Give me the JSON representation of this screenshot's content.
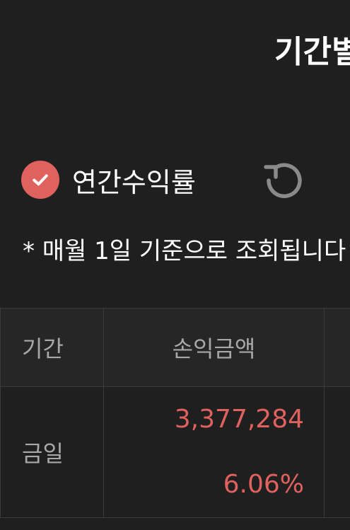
{
  "header": {
    "title": "기간별"
  },
  "option": {
    "checked": true,
    "label": "연간수익률",
    "accent_color": "#e0625f"
  },
  "note": "* 매월 1일 기준으로 조회됩니다",
  "table": {
    "columns": [
      "기간",
      "손익금액",
      ""
    ],
    "rows": [
      {
        "period": "금일",
        "amount": "3,377,284",
        "rate": "6.06%"
      }
    ]
  },
  "icons": {
    "check": "check-icon",
    "refresh": "refresh-icon"
  }
}
